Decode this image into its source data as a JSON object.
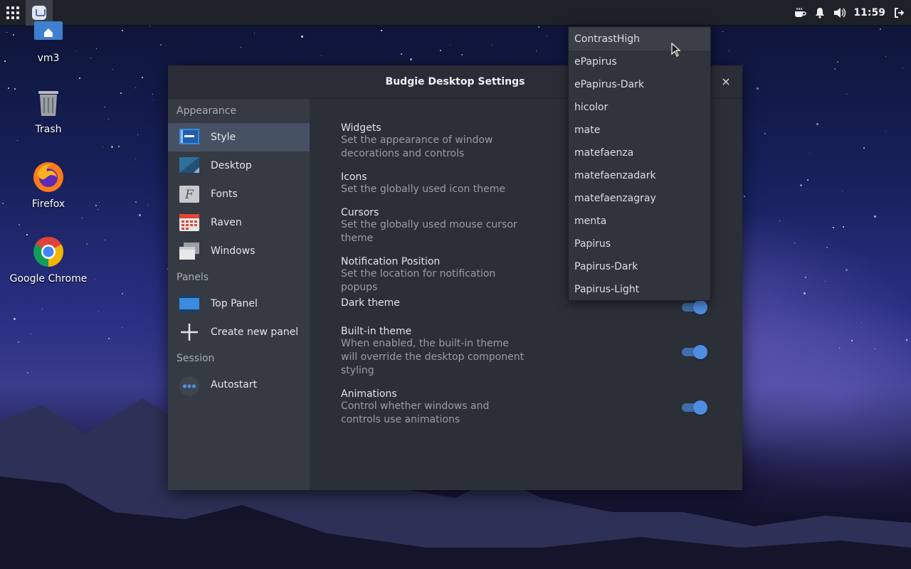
{
  "top_bar": {
    "clock": "11:59",
    "tray_icons": [
      "coffee-icon",
      "bell-icon",
      "volume-icon",
      "logout-icon"
    ]
  },
  "desktop_icons": [
    {
      "label": "vm3",
      "icon": "home-folder-icon"
    },
    {
      "label": "Trash",
      "icon": "trash-icon"
    },
    {
      "label": "Firefox",
      "icon": "firefox-icon"
    },
    {
      "label": "Google Chrome",
      "icon": "chrome-icon"
    }
  ],
  "window": {
    "title": "Budgie Desktop Settings",
    "close_symbol": "×",
    "sidebar": {
      "appearance_header": "Appearance",
      "panels_header": "Panels",
      "session_header": "Session",
      "items": {
        "style": "Style",
        "desktop": "Desktop",
        "fonts": "Fonts",
        "raven": "Raven",
        "windows": "Windows",
        "top_panel": "Top Panel",
        "create_new_panel": "Create new panel",
        "autostart": "Autostart"
      },
      "active_item": "Style"
    },
    "settings": {
      "widgets": {
        "title": "Widgets",
        "desc": "Set the appearance of window decorations and controls"
      },
      "icons": {
        "title": "Icons",
        "desc": "Set the globally used icon theme"
      },
      "cursors": {
        "title": "Cursors",
        "desc": "Set the globally used mouse cursor theme"
      },
      "notification": {
        "title": "Notification Position",
        "desc": "Set the location for notification popups"
      },
      "dark_theme": {
        "title": "Dark theme",
        "enabled": true
      },
      "builtin_theme": {
        "title": "Built-in theme",
        "desc": "When enabled, the built-in theme will override the desktop component styling",
        "enabled": true
      },
      "animations": {
        "title": "Animations",
        "desc": "Control whether windows and controls use animations",
        "enabled": true
      }
    }
  },
  "icon_theme_dropdown": {
    "options": [
      "ContrastHigh",
      "ePapirus",
      "ePapirus-Dark",
      "hicolor",
      "mate",
      "matefaenza",
      "matefaenzadark",
      "matefaenzagray",
      "menta",
      "Papirus",
      "Papirus-Dark",
      "Papirus-Light"
    ],
    "hovered": "ContrastHigh"
  },
  "colors": {
    "accent": "#4f8de2",
    "sidebar_active": "#465264",
    "window_bg": "#2b2f37"
  }
}
